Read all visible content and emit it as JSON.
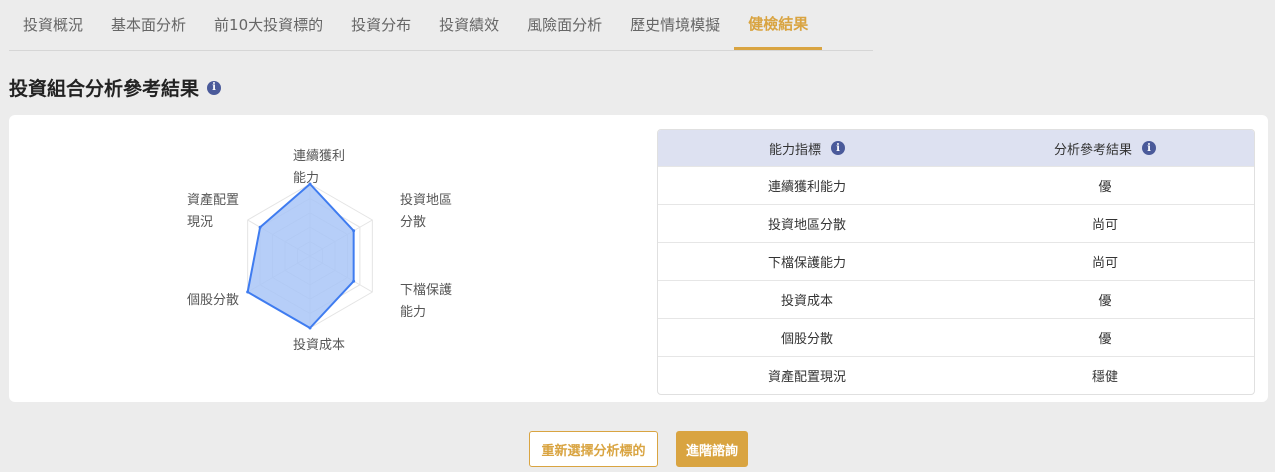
{
  "tabs": [
    {
      "label": "投資概況",
      "active": false
    },
    {
      "label": "基本面分析",
      "active": false
    },
    {
      "label": "前10大投資標的",
      "active": false
    },
    {
      "label": "投資分布",
      "active": false
    },
    {
      "label": "投資績效",
      "active": false
    },
    {
      "label": "風險面分析",
      "active": false
    },
    {
      "label": "歷史情境模擬",
      "active": false
    },
    {
      "label": "健檢結果",
      "active": true
    }
  ],
  "section": {
    "title": "投資組合分析參考結果",
    "info_icon": "i"
  },
  "radar": {
    "labels": {
      "top_line1": "連續獲利",
      "top_line2": "能力",
      "upper_right_line1": "投資地區",
      "upper_right_line2": "分散",
      "lower_right_line1": "下檔保護",
      "lower_right_line2": "能力",
      "bottom": "投資成本",
      "lower_left": "個股分散",
      "upper_left_line1": "資產配置",
      "upper_left_line2": "現況"
    },
    "levels": 5,
    "colors": {
      "fill": "#a9c6f7",
      "stroke": "#3f7cf0",
      "grid": "#e4e4e4"
    }
  },
  "chart_data": {
    "type": "radar",
    "categories": [
      "連續獲利能力",
      "投資地區分散",
      "下檔保護能力",
      "投資成本",
      "個股分散",
      "資產配置現況"
    ],
    "values": [
      1.0,
      0.7,
      0.7,
      1.0,
      1.0,
      0.8
    ],
    "ylim": [
      0,
      1
    ]
  },
  "table": {
    "headers": [
      "能力指標",
      "分析參考結果"
    ],
    "rows": [
      [
        "連續獲利能力",
        "優"
      ],
      [
        "投資地區分散",
        "尚可"
      ],
      [
        "下檔保護能力",
        "尚可"
      ],
      [
        "投資成本",
        "優"
      ],
      [
        "個股分散",
        "優"
      ],
      [
        "資產配置現況",
        "穩健"
      ]
    ]
  },
  "buttons": {
    "reselect": "重新選擇分析標的",
    "consult": "進階諮詢"
  },
  "colors": {
    "accent": "#d9a441",
    "header_bg": "#dde1f1",
    "info_icon": "#4a5a9a"
  }
}
